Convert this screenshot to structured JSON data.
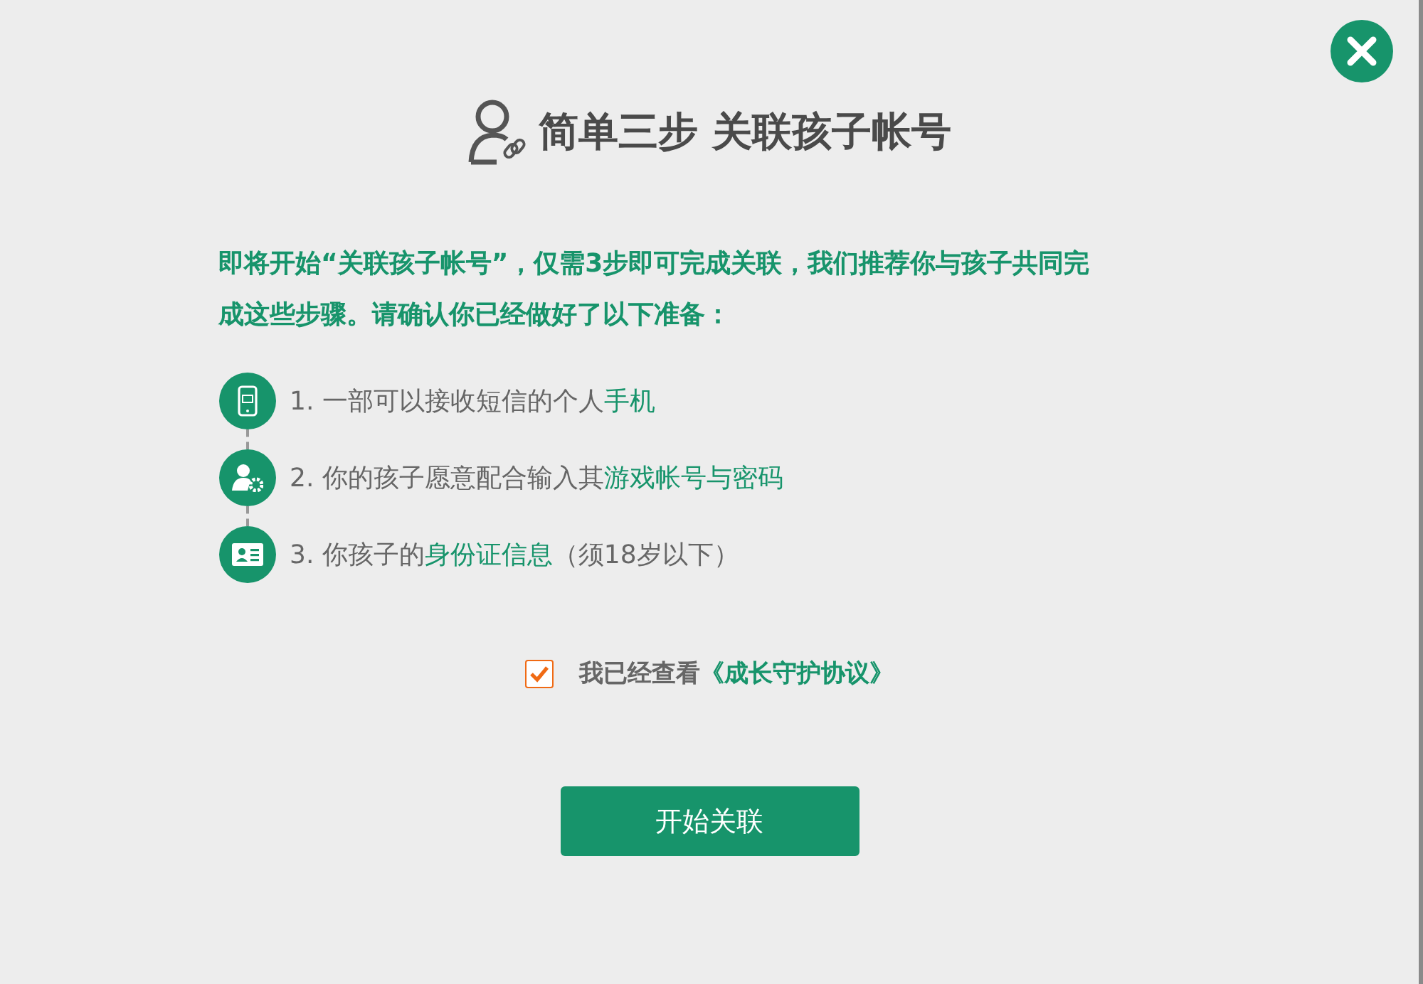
{
  "title": "简单三步 关联孩子帐号",
  "intro": "即将开始“关联孩子帐号”，仅需3步即可完成关联，我们推荐你与孩子共同完成这些步骤。请确认你已经做好了以下准备：",
  "steps": [
    {
      "kind": "phone",
      "parts": [
        {
          "text": "1. 一部可以接收短信的个人",
          "highlight": false
        },
        {
          "text": "手机",
          "highlight": true
        }
      ]
    },
    {
      "kind": "user-gear",
      "parts": [
        {
          "text": "2. 你的孩子愿意配合输入其",
          "highlight": false
        },
        {
          "text": "游戏帐号与密码",
          "highlight": true
        }
      ]
    },
    {
      "kind": "id-card",
      "parts": [
        {
          "text": "3. 你孩子的",
          "highlight": false
        },
        {
          "text": "身份证信息",
          "highlight": true
        },
        {
          "text": "（须18岁以下）",
          "highlight": false
        }
      ]
    }
  ],
  "agreement": {
    "checked": true,
    "label": "我已经查看",
    "link": "《成长守护协议》"
  },
  "button": "开始关联"
}
